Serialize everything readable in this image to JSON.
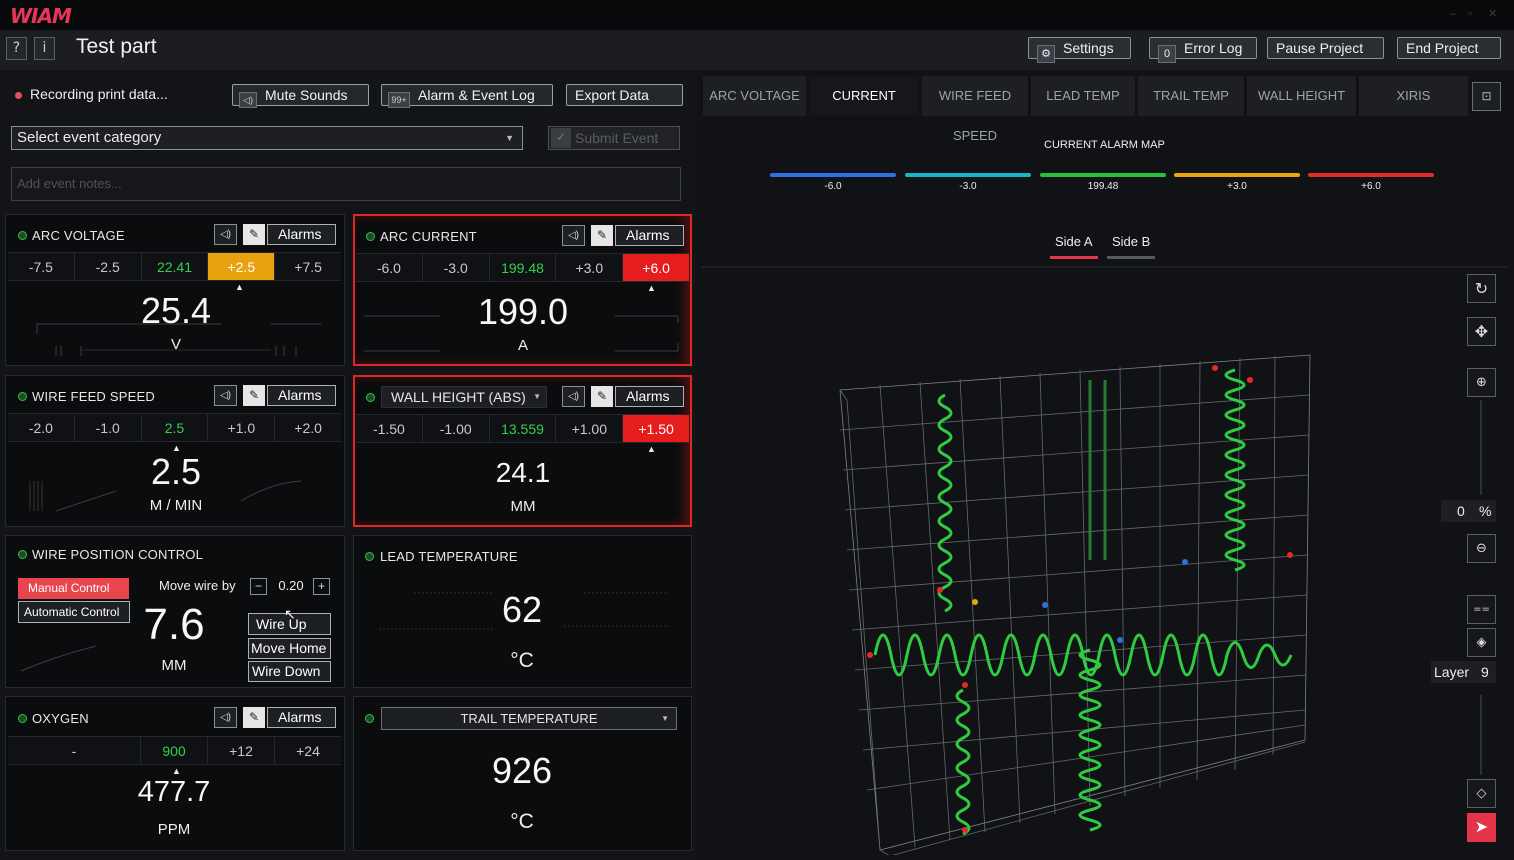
{
  "app": {
    "logo": "WIAM"
  },
  "titlebar": {
    "help": "?",
    "info": "i",
    "title": "Test part",
    "settings": "Settings",
    "error_log_count": "0",
    "error_log": "Error Log",
    "pause": "Pause Project",
    "end": "End Project"
  },
  "recording": {
    "status": "Recording print data...",
    "mute": "Mute Sounds",
    "alarm_log_count": "99+",
    "alarm_log": "Alarm & Event Log",
    "export": "Export Data"
  },
  "event": {
    "category": "Select event category",
    "submit": "Submit Event",
    "notes_placeholder": "Add event notes..."
  },
  "cards": {
    "alarms_label": "Alarms",
    "arc_voltage": {
      "label": "ARC VOLTAGE",
      "scale": [
        "-7.5",
        "-2.5",
        "22.41",
        "+2.5",
        "+7.5"
      ],
      "value": "25.4",
      "unit": "V"
    },
    "arc_current": {
      "label": "ARC CURRENT",
      "scale": [
        "-6.0",
        "-3.0",
        "199.48",
        "+3.0",
        "+6.0"
      ],
      "value": "199.0",
      "unit": "A"
    },
    "wire_feed": {
      "label": "WIRE FEED SPEED",
      "scale": [
        "-2.0",
        "-1.0",
        "2.5",
        "+1.0",
        "+2.0"
      ],
      "value": "2.5",
      "unit": "M / MIN"
    },
    "wall_height": {
      "label": "WALL HEIGHT (ABS)",
      "scale": [
        "-1.50",
        "-1.00",
        "13.559",
        "+1.00",
        "+1.50"
      ],
      "value": "24.1",
      "unit": "MM"
    },
    "wire_position": {
      "label": "WIRE POSITION CONTROL",
      "manual": "Manual Control",
      "automatic": "Automatic Control",
      "move_by_label": "Move wire by",
      "minus": "−",
      "step": "0.20",
      "plus": "+",
      "value": "7.6",
      "unit": "MM",
      "wire_up": "Wire Up",
      "move_home": "Move Home",
      "wire_down": "Wire Down"
    },
    "lead_temp": {
      "label": "LEAD TEMPERATURE",
      "value": "62",
      "unit": "°C"
    },
    "oxygen": {
      "label": "OXYGEN",
      "scale": [
        "-",
        "900",
        "+12",
        "+24"
      ],
      "value": "477.7",
      "unit": "PPM"
    },
    "trail_temp": {
      "label": "TRAIL TEMPERATURE",
      "value": "926",
      "unit": "°C"
    }
  },
  "tabs": [
    "ARC VOLTAGE",
    "CURRENT",
    "WIRE FEED SPEED",
    "LEAD TEMP",
    "TRAIL TEMP",
    "WALL HEIGHT",
    "XIRIS"
  ],
  "map": {
    "title": "CURRENT ALARM MAP",
    "legend": [
      {
        "value": "-6.0",
        "color": "#2f6fe6"
      },
      {
        "value": "-3.0",
        "color": "#18b4c8"
      },
      {
        "value": "199.48",
        "color": "#22c23a"
      },
      {
        "value": "+3.0",
        "color": "#e6a80e"
      },
      {
        "value": "+6.0",
        "color": "#e62a2a"
      }
    ],
    "side_a": "Side A",
    "side_b": "Side B",
    "percent_value": "0",
    "percent_sign": "%",
    "layer_label": "Layer",
    "layer_value": "9"
  },
  "icons": [
    "gear-icon",
    "speaker-icon",
    "pencil-icon",
    "refresh-icon",
    "move-icon",
    "zoom-in-icon",
    "zoom-out-icon",
    "layers-icon",
    "send-icon",
    "panel-icon"
  ]
}
